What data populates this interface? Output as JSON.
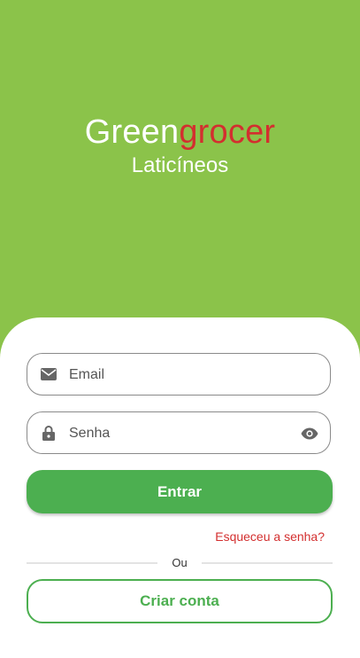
{
  "header": {
    "brand_part1": "Green",
    "brand_part2": "grocer",
    "subtitle": "Laticíneos"
  },
  "form": {
    "email_placeholder": "Email",
    "password_placeholder": "Senha",
    "email_icon": "mail-icon",
    "password_icon": "lock-icon",
    "visibility_icon": "eye-icon",
    "submit_label": "Entrar",
    "forgot_label": "Esqueceu a senha?",
    "or_label": "Ou",
    "create_account_label": "Criar conta"
  },
  "colors": {
    "background": "#8BC34A",
    "primary": "#4CAF50",
    "accent_red": "#D32F2F",
    "white": "#FFFFFF"
  }
}
